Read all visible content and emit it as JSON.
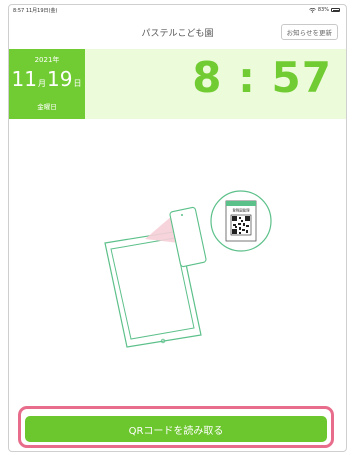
{
  "status_bar": {
    "time": "8:57 11月19日(金)",
    "battery_label": "83%",
    "battery_level": 0.83
  },
  "header": {
    "title": "パステルこども園",
    "refresh_label": "お知らせを更新"
  },
  "clock": {
    "year": "2021年",
    "month": "11",
    "month_unit": "月",
    "day": "19",
    "day_unit": "日",
    "weekday": "金曜日",
    "time": "8 : 57"
  },
  "illustration": {
    "card_label": "登降園管理"
  },
  "scan_button": {
    "label": "QRコードを読み取る"
  },
  "colors": {
    "accent": "#71cc33",
    "panel_bg": "#ecfbd9",
    "highlight": "#e86d8c"
  }
}
